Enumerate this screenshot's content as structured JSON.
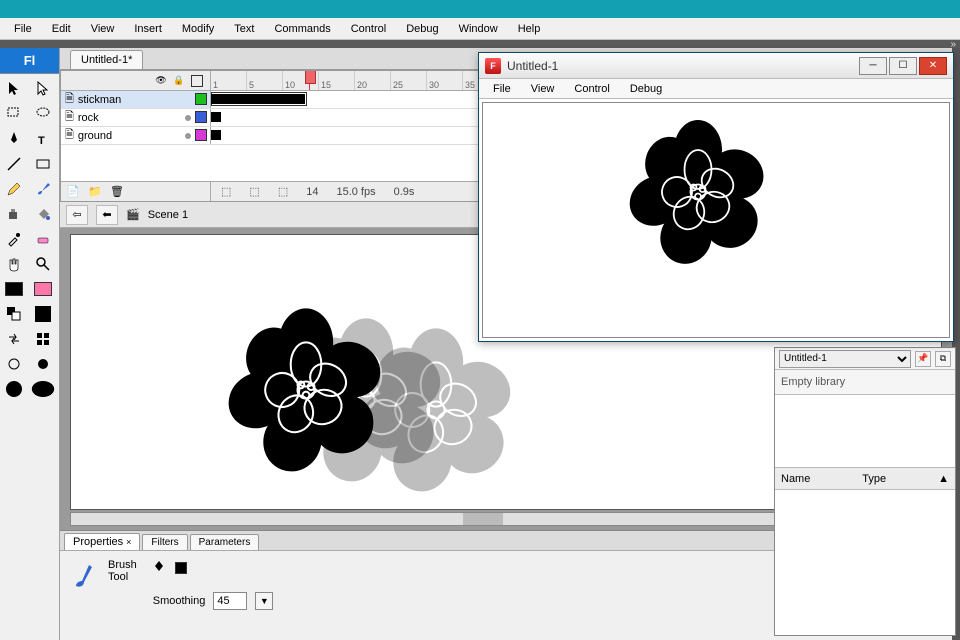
{
  "menu": {
    "items": [
      "File",
      "Edit",
      "View",
      "Insert",
      "Modify",
      "Text",
      "Commands",
      "Control",
      "Debug",
      "Window",
      "Help"
    ]
  },
  "app_icon": "Fl",
  "document_tab": "Untitled-1*",
  "timeline": {
    "ruler_ticks": [
      "1",
      "5",
      "10",
      "15",
      "20",
      "25",
      "30",
      "35"
    ],
    "layers": [
      {
        "name": "stickman",
        "selected": true,
        "color": "#1fbf1f"
      },
      {
        "name": "rock",
        "selected": false,
        "color": "#3a5fd8"
      },
      {
        "name": "ground",
        "selected": false,
        "color": "#d63ad6"
      }
    ],
    "status": {
      "frame": "14",
      "fps": "15.0 fps",
      "time": "0.9s"
    }
  },
  "scene": {
    "name": "Scene 1"
  },
  "properties": {
    "tabs": [
      "Properties",
      "Filters",
      "Parameters"
    ],
    "tool_line1": "Brush",
    "tool_line2": "Tool",
    "smoothing_label": "Smoothing",
    "smoothing_value": "45"
  },
  "library": {
    "doc": "Untitled-1",
    "empty": "Empty library",
    "col_name": "Name",
    "col_type": "Type"
  },
  "player": {
    "title": "Untitled-1",
    "menu": [
      "File",
      "View",
      "Control",
      "Debug"
    ]
  },
  "tool_names": [
    "selection-tool",
    "subselection-tool",
    "lasso-tool",
    "free-transform-tool",
    "pen-tool",
    "text-tool",
    "line-tool",
    "rectangle-tool",
    "pencil-tool",
    "brush-tool",
    "ink-bottle-tool",
    "paint-bucket-tool",
    "eyedropper-tool",
    "eraser-tool",
    "hand-tool",
    "zoom-tool"
  ]
}
